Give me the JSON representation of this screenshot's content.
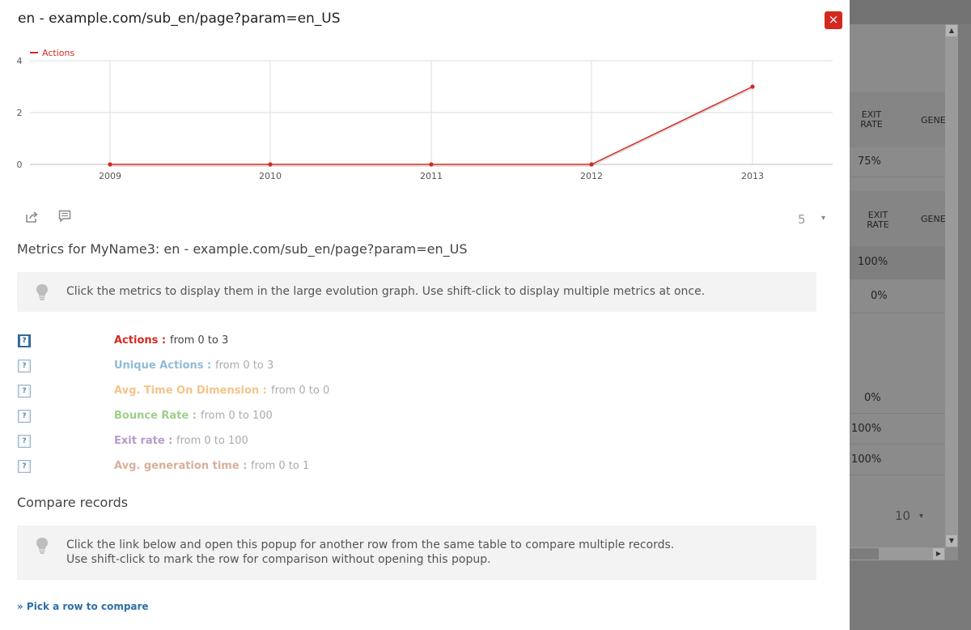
{
  "popup": {
    "title": "en - example.com/sub_en/page?param=en_US",
    "close_label": "×"
  },
  "chart_data": {
    "type": "line",
    "x": [
      "2009",
      "2010",
      "2011",
      "2012",
      "2013"
    ],
    "series": [
      {
        "name": "Actions",
        "values": [
          0,
          0,
          0,
          0,
          3
        ],
        "color": "#d4291f"
      }
    ],
    "yticks": [
      0,
      2,
      4
    ],
    "ylim": [
      0,
      4
    ],
    "grid": true,
    "legend": "top-left"
  },
  "footer": {
    "export_icon": "export-icon",
    "annotation_icon": "annotation-icon",
    "limit_value": "5",
    "limit_arrow": "▾"
  },
  "metrics_section": {
    "title": "Metrics for MyName3: en - example.com/sub_en/page?param=en_US",
    "hint": "Click the metrics to display them in the large evolution graph. Use shift-click to display multiple metrics at once.",
    "hint_icon": "lightbulb-icon",
    "items": [
      {
        "label": "Actions :",
        "range": "from 0 to 3",
        "color": "#d4291f",
        "range_color": "#444444",
        "checked": true
      },
      {
        "label": "Unique Actions :",
        "range": "from 0 to 3",
        "color": "#8fbcd8",
        "range_color": "#aaaaaa",
        "checked": false
      },
      {
        "label": "Avg. Time On Dimension :",
        "range": "from 0 to 0",
        "color": "#f6c38a",
        "range_color": "#aaaaaa",
        "checked": false
      },
      {
        "label": "Bounce Rate :",
        "range": "from 0 to 100",
        "color": "#9bd08c",
        "range_color": "#aaaaaa",
        "checked": false
      },
      {
        "label": "Exit rate :",
        "range": "from 0 to 100",
        "color": "#b79bcd",
        "range_color": "#aaaaaa",
        "checked": false
      },
      {
        "label": "Avg. generation time :",
        "range": "from 0 to 1",
        "color": "#d8b09a",
        "range_color": "#aaaaaa",
        "checked": false
      }
    ]
  },
  "compare_section": {
    "title": "Compare records",
    "hint_line1": "Click the link below and open this popup for another row from the same table to compare multiple records.",
    "hint_line2": "Use shift-click to mark the row for comparison without opening this popup.",
    "hint_icon": "lightbulb-icon",
    "link_label": "» Pick a row to compare"
  },
  "background_table": {
    "header1": {
      "col1": "EXIT RATE",
      "col2": "GENE"
    },
    "row1": "75%",
    "header2": {
      "col1": "EXIT RATE",
      "col2": "GENE"
    },
    "rows": [
      "100%",
      "0%",
      "0%",
      "100%",
      "100%"
    ],
    "limit_value": "10",
    "limit_arrow": "▾"
  }
}
